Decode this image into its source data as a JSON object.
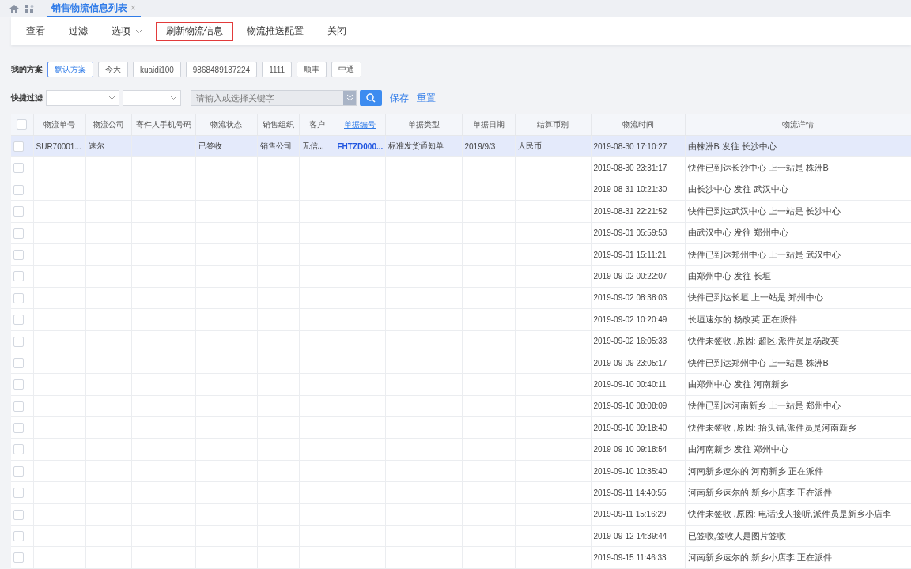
{
  "tabs": [
    {
      "label": "销售物流信息列表",
      "close": "×",
      "selected": true
    }
  ],
  "toolbar": [
    {
      "label": "查看",
      "dropdown": false,
      "highlighted": false
    },
    {
      "label": "过滤",
      "dropdown": false,
      "highlighted": false
    },
    {
      "label": "选项",
      "dropdown": true,
      "highlighted": false
    },
    {
      "label": "刷新物流信息",
      "dropdown": false,
      "highlighted": true
    },
    {
      "label": "物流推送配置",
      "dropdown": false,
      "highlighted": false
    },
    {
      "label": "关闭",
      "dropdown": false,
      "highlighted": false
    }
  ],
  "schemes": {
    "label": "我的方案",
    "items": [
      {
        "label": "默认方案",
        "selected": true
      },
      {
        "label": "今天",
        "selected": false
      },
      {
        "label": "kuaidi100",
        "selected": false
      },
      {
        "label": "9868489137224",
        "selected": false
      },
      {
        "label": "1111",
        "selected": false
      },
      {
        "label": "顺丰",
        "selected": false
      },
      {
        "label": "中通",
        "selected": false
      }
    ]
  },
  "quick_filter": {
    "label": "快捷过滤",
    "search_placeholder": "请输入或选择关键字",
    "links": [
      "保存",
      "重置"
    ]
  },
  "table": {
    "select_all_checked": false,
    "columns": [
      {
        "label": "物流单号",
        "link": false
      },
      {
        "label": "物流公司",
        "link": false
      },
      {
        "label": "寄件人手机号码",
        "link": false
      },
      {
        "label": "物流状态",
        "link": false
      },
      {
        "label": "销售组织",
        "link": false
      },
      {
        "label": "客户",
        "link": false
      },
      {
        "label": "单据编号",
        "link": true
      },
      {
        "label": "单据类型",
        "link": false
      },
      {
        "label": "单据日期",
        "link": false
      },
      {
        "label": "结算币别",
        "link": false
      },
      {
        "label": "物流时间",
        "link": false
      },
      {
        "label": "物流详情",
        "link": false
      }
    ],
    "rows": [
      {
        "selected": true,
        "checked": false,
        "tracking_no": "SUR70001...",
        "carrier": "速尔",
        "status": "已签收",
        "sales_org": "销售公司",
        "customer": "无信...",
        "doc_no": "FHTZD000...",
        "doc_type": "标准发货通知单",
        "doc_date": "2019/9/3",
        "currency": "人民币",
        "time": "2019-08-30 17:10:27",
        "detail": "由株洲B 发往 长沙中心"
      },
      {
        "selected": false,
        "checked": false,
        "time": "2019-08-30 23:31:17",
        "detail": "快件已到达长沙中心 上一站是 株洲B"
      },
      {
        "selected": false,
        "checked": false,
        "time": "2019-08-31 10:21:30",
        "detail": "由长沙中心 发往 武汉中心"
      },
      {
        "selected": false,
        "checked": false,
        "time": "2019-08-31 22:21:52",
        "detail": "快件已到达武汉中心 上一站是 长沙中心"
      },
      {
        "selected": false,
        "checked": false,
        "time": "2019-09-01 05:59:53",
        "detail": "由武汉中心 发往 郑州中心"
      },
      {
        "selected": false,
        "checked": false,
        "time": "2019-09-01 15:11:21",
        "detail": "快件已到达郑州中心 上一站是 武汉中心"
      },
      {
        "selected": false,
        "checked": false,
        "time": "2019-09-02 00:22:07",
        "detail": "由郑州中心 发往 长垣"
      },
      {
        "selected": false,
        "checked": false,
        "time": "2019-09-02 08:38:03",
        "detail": "快件已到达长垣 上一站是 郑州中心"
      },
      {
        "selected": false,
        "checked": false,
        "time": "2019-09-02 10:20:49",
        "detail": "长垣速尔的 杨改英 正在派件"
      },
      {
        "selected": false,
        "checked": false,
        "time": "2019-09-02 16:05:33",
        "detail": "快件未签收 ,原因: 超区,派件员是杨改英"
      },
      {
        "selected": false,
        "checked": false,
        "time": "2019-09-09 23:05:17",
        "detail": "快件已到达郑州中心 上一站是 株洲B"
      },
      {
        "selected": false,
        "checked": false,
        "time": "2019-09-10 00:40:11",
        "detail": "由郑州中心 发往 河南新乡"
      },
      {
        "selected": false,
        "checked": false,
        "time": "2019-09-10 08:08:09",
        "detail": "快件已到达河南新乡 上一站是 郑州中心"
      },
      {
        "selected": false,
        "checked": false,
        "time": "2019-09-10 09:18:40",
        "detail": "快件未签收 ,原因: 抬头错,派件员是河南新乡"
      },
      {
        "selected": false,
        "checked": false,
        "time": "2019-09-10 09:18:54",
        "detail": "由河南新乡 发往 郑州中心"
      },
      {
        "selected": false,
        "checked": false,
        "time": "2019-09-10 10:35:40",
        "detail": "河南新乡速尔的 河南新乡 正在派件"
      },
      {
        "selected": false,
        "checked": false,
        "time": "2019-09-11 14:40:55",
        "detail": "河南新乡速尔的 新乡小店李 正在派件"
      },
      {
        "selected": false,
        "checked": false,
        "time": "2019-09-11 15:16:29",
        "detail": "快件未签收 ,原因: 电话没人接听,派件员是新乡小店李"
      },
      {
        "selected": false,
        "checked": false,
        "time": "2019-09-12 14:39:44",
        "detail": "已签收,签收人是图片签收"
      },
      {
        "selected": false,
        "checked": false,
        "time": "2019-09-15 11:46:33",
        "detail": "河南新乡速尔的 新乡小店李 正在派件"
      }
    ]
  }
}
